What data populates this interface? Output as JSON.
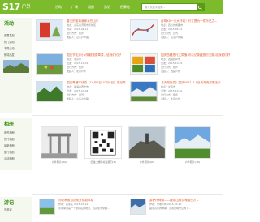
{
  "brand": {
    "logo": "S17",
    "logo_sub": "户外"
  },
  "nav": [
    "活动",
    "广场",
    "相册",
    "游记",
    "招募帖"
  ],
  "search": {
    "placeholder": "输入关键字搜索..."
  },
  "activity": {
    "title": "活动",
    "side_links": [
      "我要发起",
      "热门活动",
      "本周活动",
      "即将出发"
    ],
    "cards": [
      {
        "title": "春天的故事我家乡在山东",
        "lines": [
          "地点：山东省济南市历城区",
          "时间：2015-04-11",
          "出行方式：徒步",
          "发起人：山东户外路"
        ]
      },
      {
        "title": "自驾XX一川大环线！行亡是为一件乐记之...",
        "lines": [
          "地点：四川省成都市",
          "出发：2015-05-01",
          "出行方式：自驾",
          "发起人：山东户外路"
        ]
      },
      {
        "title": "国庆节北京小V穿越毫德草原，给我们约好",
        "lines": [
          "地点：北京市",
          "出发：2015-10-01",
          "出行方式：徒步",
          "发起人：北京户外"
        ]
      },
      {
        "title": "国庆西藏旅行之周鬼-可以记录藏旅行天路-给我们约好",
        "lines": [
          "地点：西藏拉萨市",
          "出发：2015-10-01",
          "出行方式：徒步",
          "发起人：西藏户外"
        ]
      },
      {
        "title": "国庆青藏环线游【10月4日-10月9日】南泥湾-...",
        "lines": [
          "地点：青海省西宁市",
          "出发：2015-10-04",
          "出行方式：自驾",
          "发起人：山东户外路"
        ]
      },
      {
        "title": "【天湖南游】国庆0071 8-6日天湖南游雪走步",
        "lines": [
          "地点：北京市",
          "出发：2015-10-01",
          "出行方式：徒步",
          "发起人：北京户外"
        ]
      }
    ]
  },
  "album": {
    "title": "相册",
    "side_links": [
      "我的相册",
      "热门相册",
      "最新相册",
      "旅行相册",
      "活动相册"
    ],
    "items": [
      {
        "caption": "户外照片(80)"
      },
      {
        "caption": "扫描二维码关注我们(3)"
      },
      {
        "caption": "户外照片(60)"
      },
      {
        "caption": "户外照片(18)"
      }
    ]
  },
  "travelogue": {
    "title": "游记",
    "side_links": [
      "写游记"
    ],
    "items": [
      {
        "title": "河北承德百花坝大穿越草原",
        "meta": "作者：石家庄  2015-03-12",
        "desc": "河北承德是一个很有名的地方，百花坝大穿越..."
      },
      {
        "title": "游萨托神湖——藏北山南贡嘎雪日才...",
        "meta": "作者：雪域户外  2015-03-10",
        "desc": "藏北高原的神湖，山南贡嘎雪山脚下..."
      }
    ]
  },
  "colors": {
    "brand_green": "#7cbb2b",
    "title_orange": "#e05d2a",
    "side_bg": "#f4f8ee"
  }
}
